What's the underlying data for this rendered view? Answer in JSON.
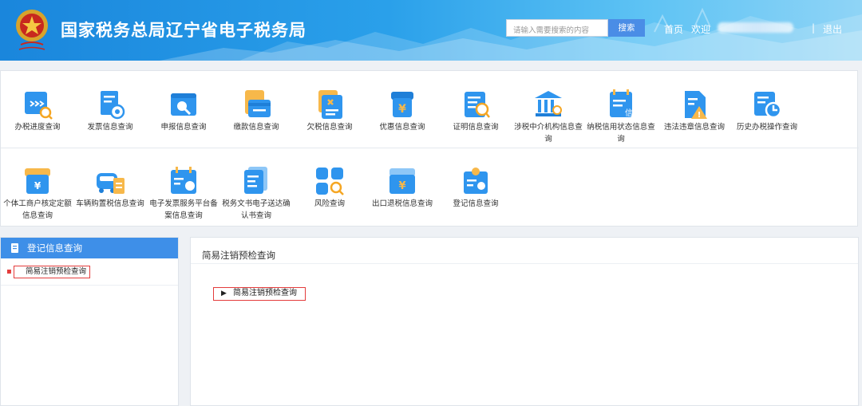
{
  "header": {
    "title": "国家税务总局辽宁省电子税务局",
    "search_placeholder": "请输入需要搜索的内容",
    "search_button": "搜索",
    "home_link": "首页",
    "welcome_text": "欢迎",
    "separator": "|",
    "logout_link": "退出"
  },
  "icon_panel": {
    "row1": [
      {
        "label": "办税进度查询",
        "icon": "progress-icon"
      },
      {
        "label": "发票信息查询",
        "icon": "invoice-icon"
      },
      {
        "label": "申报信息查询",
        "icon": "declaration-icon"
      },
      {
        "label": "缴款信息查询",
        "icon": "payment-icon"
      },
      {
        "label": "欠税信息查询",
        "icon": "arrears-icon"
      },
      {
        "label": "优惠信息查询",
        "icon": "preferential-icon"
      },
      {
        "label": "证明信息查询",
        "icon": "certificate-icon"
      },
      {
        "label": "涉税中介机构信息查询",
        "icon": "agency-icon"
      },
      {
        "label": "纳税信用状态信息查询",
        "icon": "credit-icon"
      },
      {
        "label": "违法违章信息查询",
        "icon": "violation-icon"
      },
      {
        "label": "历史办税操作查询",
        "icon": "history-icon"
      }
    ],
    "row2": [
      {
        "label": "个体工商户核定定额信息查询",
        "icon": "individual-business-icon"
      },
      {
        "label": "车辆购置税信息查询",
        "icon": "vehicle-icon"
      },
      {
        "label": "电子发票服务平台备案信息查询",
        "icon": "e-invoice-icon"
      },
      {
        "label": "税务文书电子送达确认书查询",
        "icon": "document-icon"
      },
      {
        "label": "风险查询",
        "icon": "risk-icon"
      },
      {
        "label": "出口退税信息查询",
        "icon": "export-refund-icon"
      },
      {
        "label": "登记信息查询",
        "icon": "registration-icon"
      }
    ]
  },
  "sidebar": {
    "title": "登记信息查询",
    "items": [
      {
        "label": "简易注销预检查询",
        "selected": true
      }
    ]
  },
  "main": {
    "title": "简易注销预检查询",
    "link": "简易注销预检查询"
  },
  "colors": {
    "header_blue": "#1a86dc",
    "accent_blue": "#3e8fe8",
    "highlight_red": "#e43c3c"
  }
}
